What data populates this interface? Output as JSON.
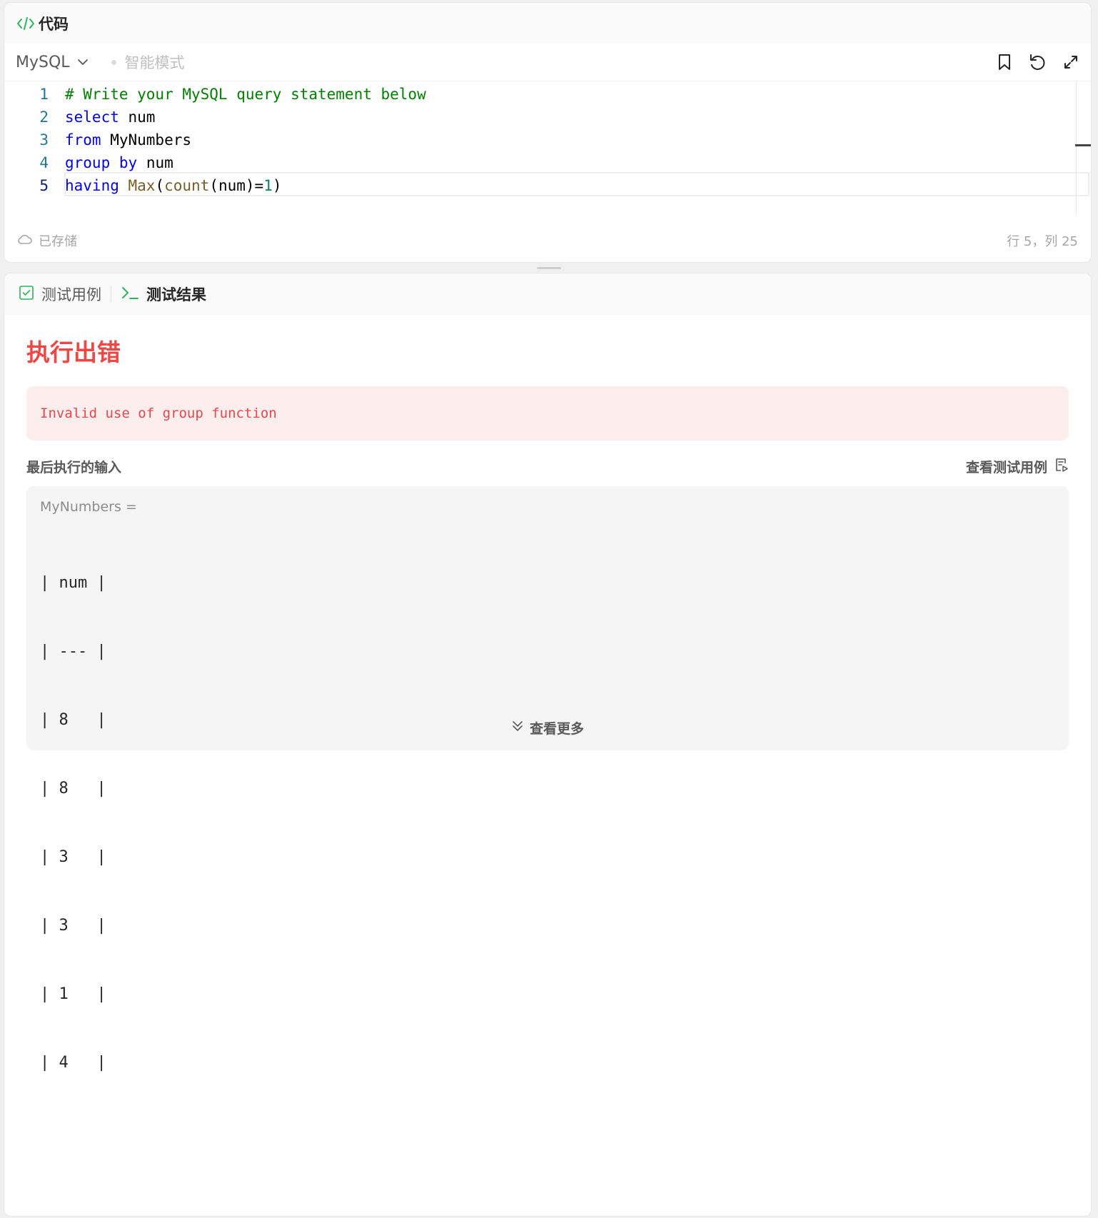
{
  "code_panel": {
    "title": "代码",
    "language": "MySQL",
    "mode_label": "智能模式",
    "lines": [
      {
        "num": "1"
      },
      {
        "num": "2"
      },
      {
        "num": "3"
      },
      {
        "num": "4"
      },
      {
        "num": "5"
      }
    ],
    "code": {
      "l1_comment": "# Write your MySQL query statement below",
      "l2_kw": "select",
      "l2_id": " num",
      "l3_kw": "from",
      "l3_id": " MyNumbers",
      "l4_kw1": "group",
      "l4_kw2": "by",
      "l4_id": " num",
      "l5_kw": "having",
      "l5_fn1": "Max",
      "l5_p1": "(",
      "l5_fn2": "count",
      "l5_p2": "(num)",
      "l5_eq": "=",
      "l5_num": "1",
      "l5_p3": ")"
    },
    "saved_label": "已存储",
    "cursor_position": "行 5，列 25"
  },
  "result_panel": {
    "tabs": [
      {
        "label": "测试用例",
        "active": false
      },
      {
        "label": "测试结果",
        "active": true
      }
    ],
    "error_title": "执行出错",
    "error_message": "Invalid use of group function",
    "last_input_label": "最后执行的输入",
    "view_testcase_label": "查看测试用例",
    "input_var": "MyNumbers =",
    "table_rows": [
      "| num |",
      "| --- |",
      "| 8   |",
      "| 8   |",
      "| 3   |",
      "| 3   |",
      "| 1   |",
      "| 4   |"
    ],
    "more_label": "查看更多"
  },
  "colors": {
    "accent_green": "#2db55d",
    "error_red": "#ef4743",
    "error_bg": "#fdeeee"
  },
  "icons": [
    "code-icon",
    "chevron-down-icon",
    "bookmark-icon",
    "undo-icon",
    "expand-icon",
    "cloud-icon",
    "checkbox-icon",
    "terminal-icon",
    "document-icon",
    "double-chevron-down-icon"
  ]
}
